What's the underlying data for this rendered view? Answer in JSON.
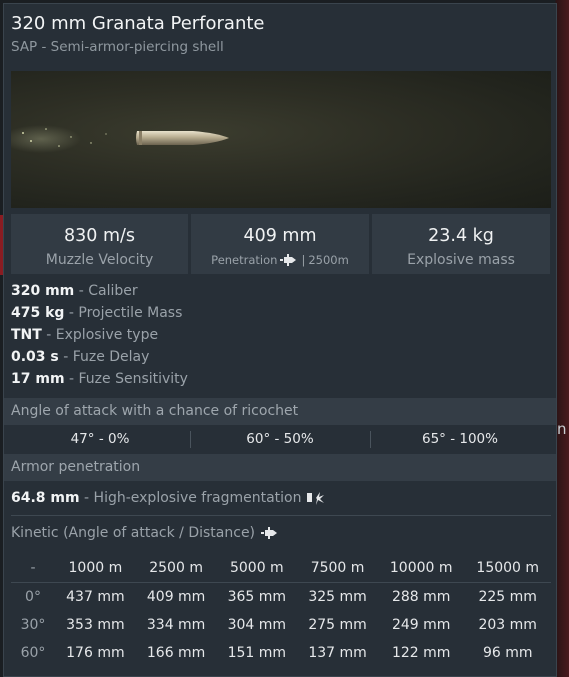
{
  "shell": {
    "title": "320 mm Granata Perforante",
    "subtitle": "SAP - Semi-armor-piercing shell"
  },
  "stats": {
    "velocity_value": "830 m/s",
    "velocity_label": "Muzzle Velocity",
    "penetration_value": "409 mm",
    "penetration_label": "Penetration",
    "penetration_distance": "2500m",
    "explosive_value": "23.4 kg",
    "explosive_label": "Explosive mass"
  },
  "info": [
    {
      "value": "320 mm",
      "label": "- Caliber"
    },
    {
      "value": "475 kg",
      "label": "- Projectile Mass"
    },
    {
      "value": "TNT",
      "label": "- Explosive type"
    },
    {
      "value": "0.03 s",
      "label": "- Fuze Delay"
    },
    {
      "value": "17 mm",
      "label": "- Fuze Sensitivity"
    }
  ],
  "ricochet": {
    "header": "Angle of attack with a chance of ricochet",
    "cells": [
      "47° - 0%",
      "60° - 50%",
      "65° - 100%"
    ]
  },
  "armor": {
    "header": "Armor penetration",
    "frag_value": "64.8 mm",
    "frag_label": "- High-explosive fragmentation",
    "kinetic_label": "Kinetic (Angle of attack / Distance)"
  },
  "table": {
    "headers": [
      "-",
      "1000 m",
      "2500 m",
      "5000 m",
      "7500 m",
      "10000 m",
      "15000 m"
    ],
    "rows": [
      {
        "angle": "0°",
        "values": [
          "437 mm",
          "409 mm",
          "365 mm",
          "325 mm",
          "288 mm",
          "225 mm"
        ]
      },
      {
        "angle": "30°",
        "values": [
          "353 mm",
          "334 mm",
          "304 mm",
          "275 mm",
          "249 mm",
          "203 mm"
        ]
      },
      {
        "angle": "60°",
        "values": [
          "176 mm",
          "166 mm",
          "151 mm",
          "137 mm",
          "122 mm",
          "96 mm"
        ]
      }
    ]
  },
  "background": {
    "edge_letter": "n"
  },
  "icons": {
    "penetration": "shell-penetration-icon",
    "fragmentation": "explosion-fragment-icon",
    "kinetic": "shell-penetration-icon"
  }
}
